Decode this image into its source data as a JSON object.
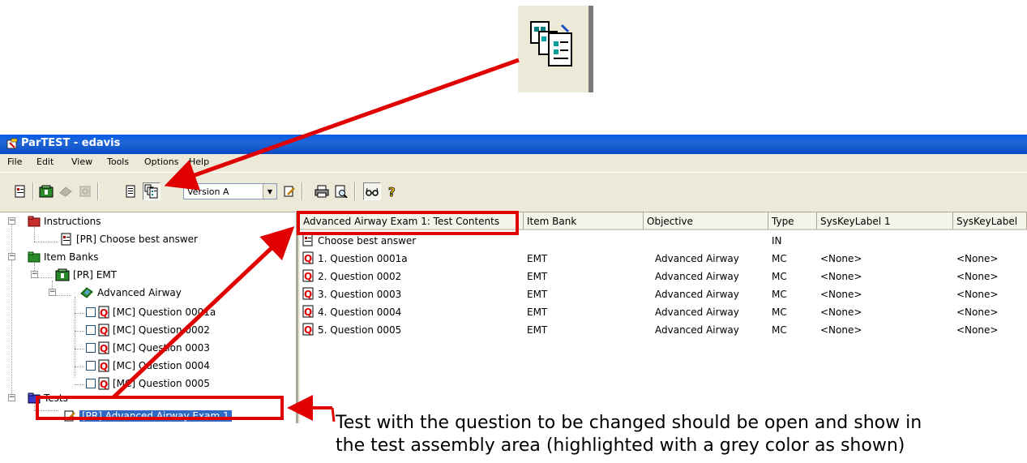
{
  "window": {
    "title": "ParTEST - edavis"
  },
  "menu": [
    "File",
    "Edit",
    "View",
    "Tools",
    "Options",
    "Help"
  ],
  "toolbar": {
    "version_select": "Version A"
  },
  "tree": {
    "instructions": {
      "label": "Instructions",
      "child": "[PR] Choose best answer"
    },
    "item_banks": {
      "label": "Item Banks",
      "bank": "[PR] EMT",
      "objective": "Advanced Airway",
      "questions": [
        "[MC] Question 0001a",
        "[MC] Question 0002",
        "[MC] Question 0003",
        "[MC] Question 0004",
        "[MC] Question 0005"
      ]
    },
    "tests": {
      "label": "Tests",
      "test": "[PR] Advanced Airway Exam 1"
    }
  },
  "list": {
    "columns": [
      "Advanced Airway Exam 1: Test Contents",
      "Item Bank",
      "Objective",
      "Type",
      "SysKeyLabel 1",
      "SysKeyLabel"
    ],
    "rows": [
      {
        "name": "Choose best answer",
        "bank": "",
        "objective": "",
        "type": "IN",
        "sk1": "",
        "sk2": ""
      },
      {
        "name": "1. Question 0001a",
        "bank": "EMT",
        "objective": "Advanced Airway",
        "type": "MC",
        "sk1": "<None>",
        "sk2": "<None>"
      },
      {
        "name": "2. Question 0002",
        "bank": "EMT",
        "objective": "Advanced Airway",
        "type": "MC",
        "sk1": "<None>",
        "sk2": "<None>"
      },
      {
        "name": "3. Question 0003",
        "bank": "EMT",
        "objective": "Advanced Airway",
        "type": "MC",
        "sk1": "<None>",
        "sk2": "<None>"
      },
      {
        "name": "4. Question 0004",
        "bank": "EMT",
        "objective": "Advanced Airway",
        "type": "MC",
        "sk1": "<None>",
        "sk2": "<None>"
      },
      {
        "name": "5. Question 0005",
        "bank": "EMT",
        "objective": "Advanced Airway",
        "type": "MC",
        "sk1": "<None>",
        "sk2": "<None>"
      }
    ]
  },
  "annotation": {
    "line1": "Test with the question to be changed should be open and show in",
    "line2": "the test assembly area (highlighted with a grey color as shown)"
  },
  "colors": {
    "annotation_red": "#e00000",
    "title_blue": "#0a5be8",
    "selection_blue": "#316ac5"
  }
}
